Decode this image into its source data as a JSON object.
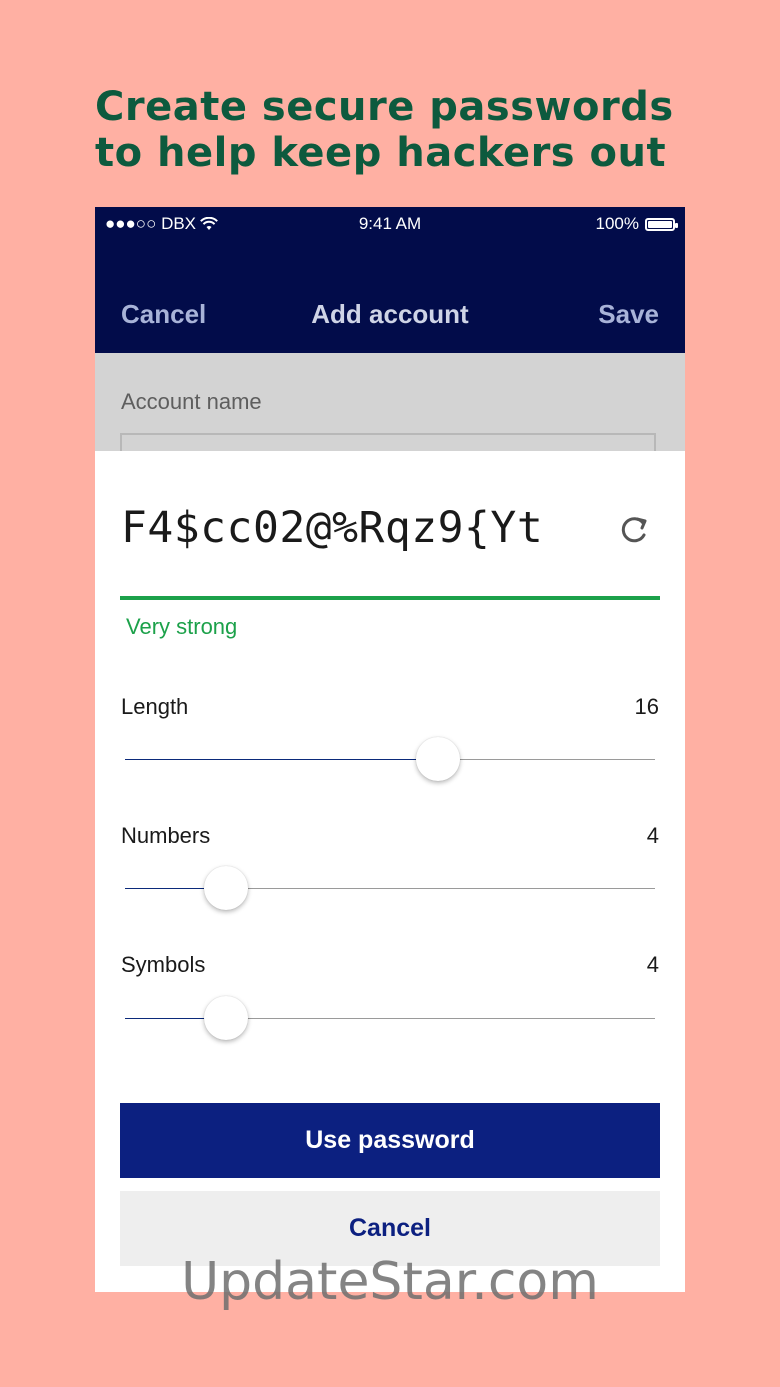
{
  "headline": {
    "line1": "Create secure passwords",
    "line2": "to help keep hackers out"
  },
  "status_bar": {
    "carrier": "●●●○○ DBX",
    "time": "9:41 AM",
    "battery": "100%"
  },
  "nav": {
    "cancel": "Cancel",
    "title": "Add account",
    "save": "Save"
  },
  "form": {
    "account_name_label": "Account name"
  },
  "generator": {
    "password": "F4$cc02@%Rqz9{Yt",
    "strength": "Very strong",
    "options": [
      {
        "label": "Length",
        "value": "16",
        "fraction": 0.59
      },
      {
        "label": "Numbers",
        "value": "4",
        "fraction": 0.19
      },
      {
        "label": "Symbols",
        "value": "4",
        "fraction": 0.19
      }
    ],
    "use_button": "Use password",
    "cancel_button": "Cancel"
  },
  "colors": {
    "background": "#ffb0a3",
    "headline": "#0d5a3e",
    "navbar": "#020c4a",
    "primary_button": "#0c2080",
    "strength": "#1ca14a"
  },
  "watermark": "UpdateStar.com"
}
